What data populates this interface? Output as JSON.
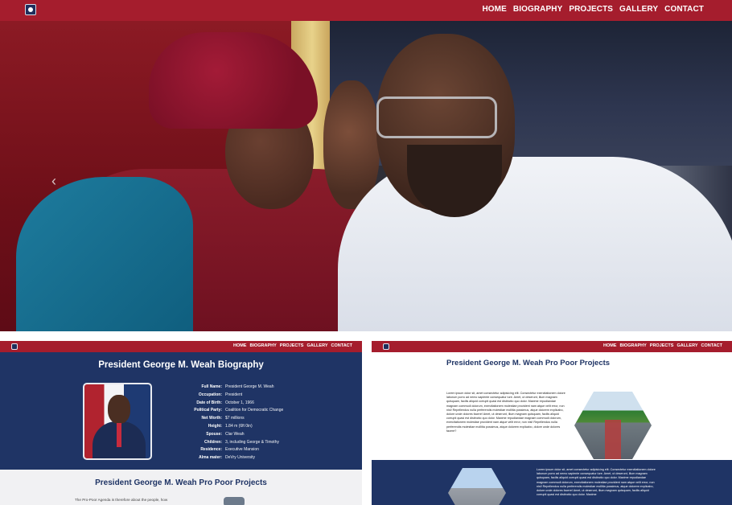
{
  "hero": {
    "nav": [
      "HOME",
      "BIOGRAPHY",
      "PROJECTS",
      "GALLERY",
      "CONTACT"
    ],
    "carousel_prev_icon": "chevron-left-icon"
  },
  "left_panel": {
    "nav": [
      "HOME",
      "BIOGRAPHY",
      "PROJECTS",
      "GALLERY",
      "CONTACT"
    ],
    "bio_title": "President George M. Weah Biography",
    "facts": [
      {
        "k": "Full Name:",
        "v": "President George M. Weah"
      },
      {
        "k": "Occupation:",
        "v": "President"
      },
      {
        "k": "Date of Birth:",
        "v": "October 1, 1966"
      },
      {
        "k": "Political Party:",
        "v": "Coalition for Democratic Change"
      },
      {
        "k": "Net Worth:",
        "v": "$7 millions"
      },
      {
        "k": "Height:",
        "v": "1.84 m (6ft 0in)"
      },
      {
        "k": "Spouse:",
        "v": "Clar Weah"
      },
      {
        "k": "Children:",
        "v": "3, including George & Timothy"
      },
      {
        "k": "Residence:",
        "v": "Executive Mansion"
      },
      {
        "k": "Alma mater:",
        "v": "DeVry University"
      }
    ],
    "projects_title": "President George M. Weah Pro Poor Projects",
    "projects_snippet": "The Pro-Poor Agenda is therefore about the people, how"
  },
  "right_panel": {
    "nav": [
      "HOME",
      "BIOGRAPHY",
      "PROJECTS",
      "GALLERY",
      "CONTACT"
    ],
    "title": "President George M. Weah Pro Poor Projects",
    "lorem": "Lorem ipsum dolor sit, amet consectetur adipisicing elit. Consectetur exercitationem dolore laborum porro ad nemo sapiente consequatur iure. Amet, ut deserunt, illum magnam quisquam, facilis aliquid corrupti quasi est distinctio quo dolor. Maxime repudiandae magnam commodi dolorum, exercitationem molestiae provident nam atque velit error, non nisi! Repellendus nulla perferendis molestiae mollitia possimus, atque dolorem explicabo, dolore unde dolores facere! Amet, ut deserunt, illum magnam quisquam, facilis aliquid corrupti quasi est distinctio quo dolor. Maxime repudiandae magnam commodi dolorum, exercitationem molestiae provident nam atque velit error, non nisi! Repellendus nulla perferendis molestiae mollitia possimus, atque dolorem explicabo, dolore unde dolores facere?",
    "lorem2": "Lorem ipsum dolor sit, amet consectetur adipisicing elit. Consectetur exercitationem dolore laborum porro ad nemo sapiente consequatur iure. Amet, ut deserunt, illum magnam quisquam, facilis aliquid corrupti quasi est distinctio quo dolor. Maxime repudiandae magnam commodi dolorum, exercitationem molestiae provident nam atque velit error, non nisi! Repellendus nulla perferendis molestiae mollitia possimus, atque dolorem explicabo, dolore unde dolores facere! Amet, ut deserunt, illum magnam quisquam, facilis aliquid corrupti quasi est distinctio quo dolor. Maxime"
  }
}
